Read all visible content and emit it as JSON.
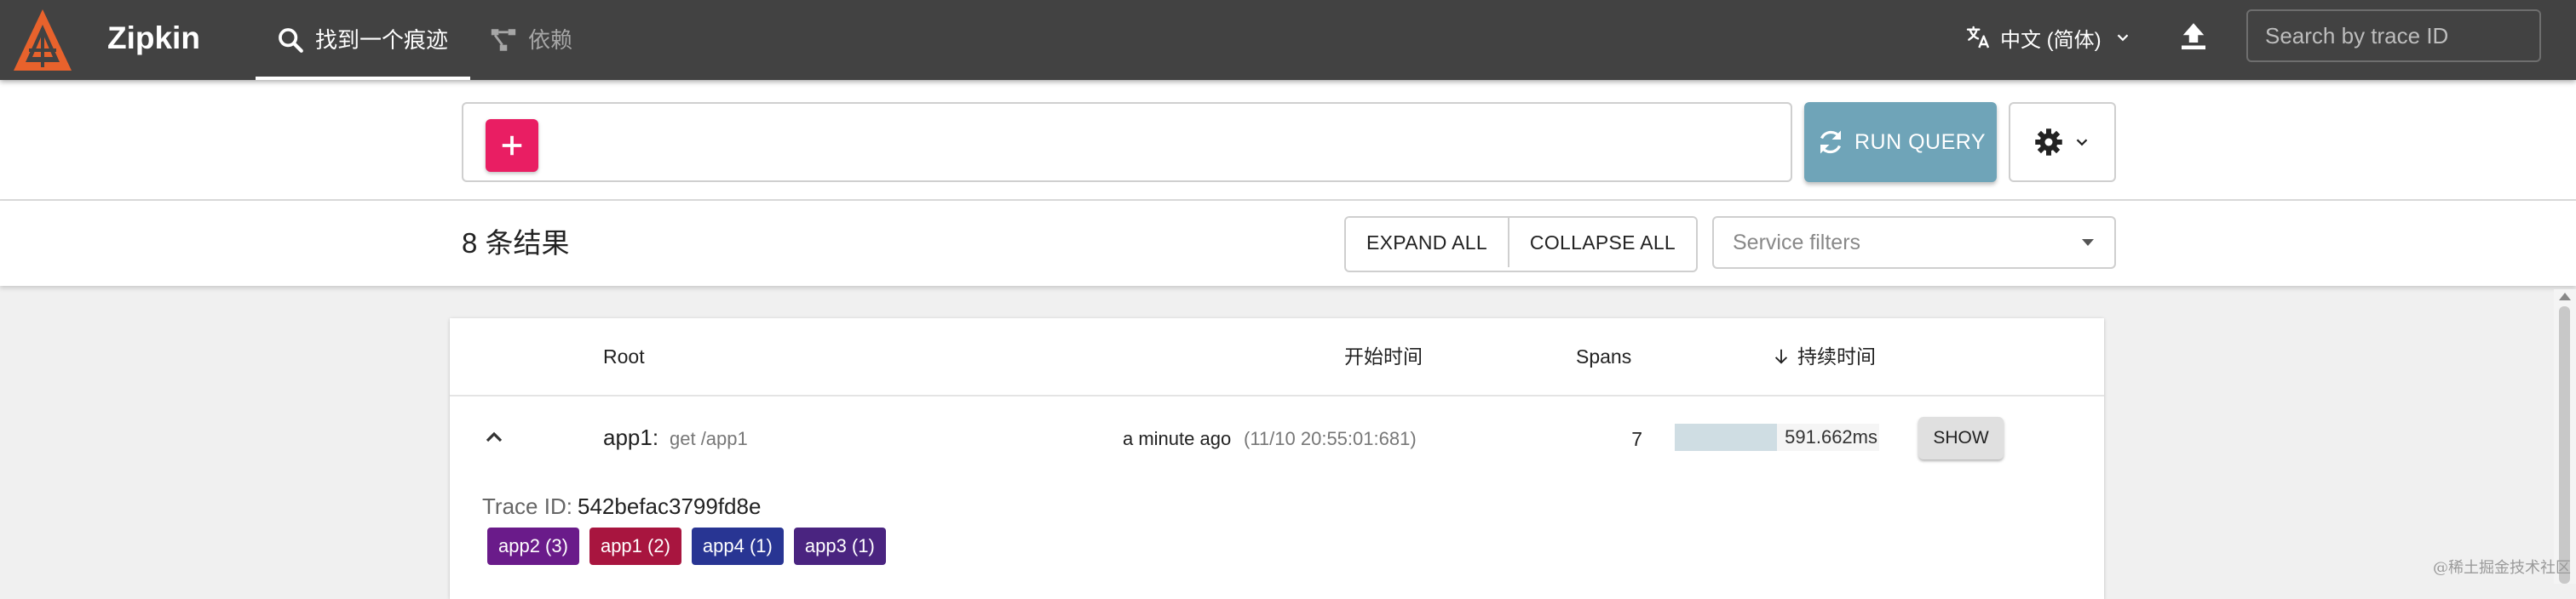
{
  "header": {
    "brand": "Zipkin",
    "tabs": [
      {
        "label": "找到一个痕迹",
        "icon": "search-icon",
        "active": true
      },
      {
        "label": "依赖",
        "icon": "dependencies-graph-icon",
        "active": false
      }
    ],
    "language": {
      "label": "中文 (简体)",
      "icon": "translate-icon"
    },
    "upload_icon": "upload-icon",
    "trace_search": {
      "placeholder": "Search by trace ID",
      "value": ""
    }
  },
  "query": {
    "add_icon": "plus-icon",
    "run_label": "RUN QUERY",
    "run_icon": "refresh-icon",
    "settings_icon": "gear-icon"
  },
  "results": {
    "count_label": "8 条结果",
    "expand_all": "EXPAND ALL",
    "collapse_all": "COLLAPSE ALL",
    "service_filter_placeholder": "Service filters"
  },
  "table": {
    "columns": {
      "root": "Root",
      "start_time": "开始时间",
      "spans": "Spans",
      "duration": "持续时间"
    },
    "sort": {
      "column": "duration",
      "direction": "descending"
    },
    "rows": [
      {
        "root_service": "app1:",
        "root_span": "get /app1",
        "start_relative": "a minute ago",
        "start_absolute": "(11/10 20:55:01:681)",
        "spans": "7",
        "duration": "591.662ms",
        "duration_fraction": 0.5,
        "show_label": "SHOW",
        "expanded": true,
        "trace_id_label": "Trace ID:",
        "trace_id": "542befac3799fd8e",
        "services": [
          {
            "label": "app2 (3)",
            "color": "#6a1b8a"
          },
          {
            "label": "app1 (2)",
            "color": "#a8153f"
          },
          {
            "label": "app4 (1)",
            "color": "#283593"
          },
          {
            "label": "app3 (1)",
            "color": "#4a2480"
          }
        ]
      }
    ]
  },
  "colors": {
    "header_bg": "#424242",
    "accent_pink": "#e91e63",
    "run_query_bg": "#6fa4b8",
    "duration_fill": "#cfdde3",
    "logo_orange": "#e8622c"
  },
  "watermark": "@稀土掘金技术社区"
}
